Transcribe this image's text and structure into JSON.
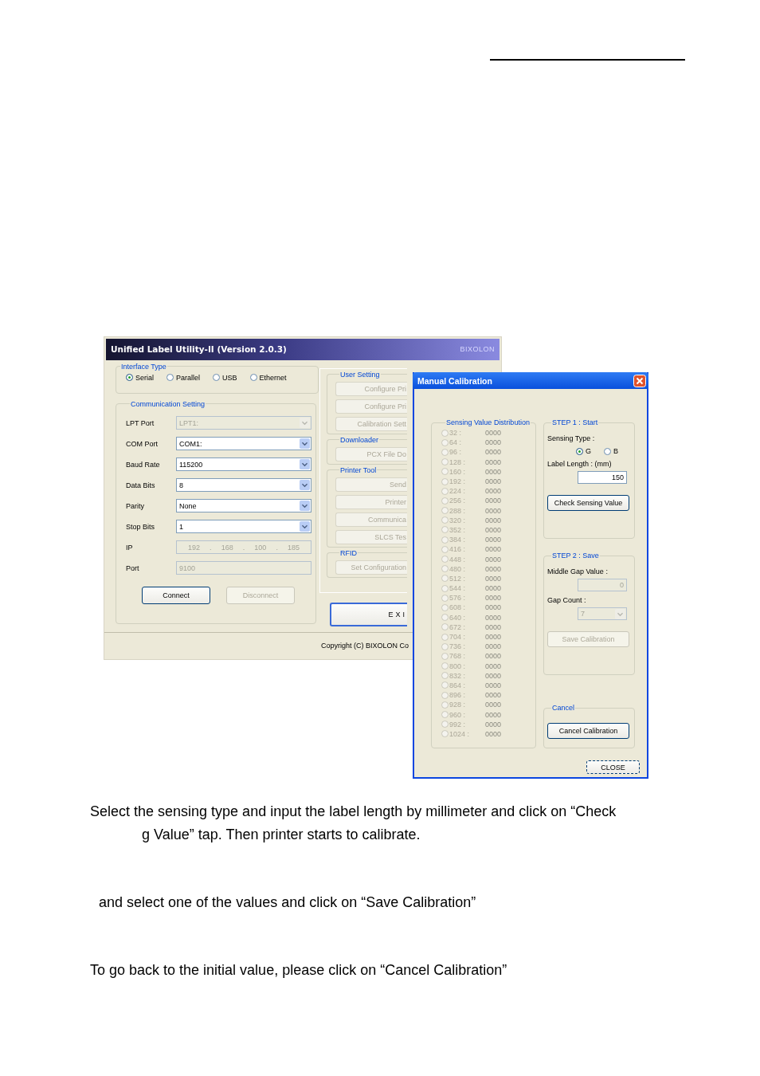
{
  "main_window": {
    "title": "Unified Label Utility-II (Version 2.0.3)",
    "brand": "BIXOLON",
    "interface_type": {
      "label": "Interface Type",
      "options": [
        {
          "label": "Serial",
          "selected": true
        },
        {
          "label": "Parallel",
          "selected": false
        },
        {
          "label": "USB",
          "selected": false
        },
        {
          "label": "Ethernet",
          "selected": false
        }
      ]
    },
    "communication": {
      "label": "Communication Setting",
      "fields": [
        {
          "label": "LPT Port",
          "kind": "dropdown",
          "value": "LPT1:",
          "disabled": true
        },
        {
          "label": "COM Port",
          "kind": "dropdown",
          "value": "COM1:",
          "disabled": false
        },
        {
          "label": "Baud Rate",
          "kind": "dropdown",
          "value": "115200",
          "disabled": false
        },
        {
          "label": "Data Bits",
          "kind": "dropdown",
          "value": "8",
          "disabled": false
        },
        {
          "label": "Parity",
          "kind": "dropdown",
          "value": "None",
          "disabled": false
        },
        {
          "label": "Stop Bits",
          "kind": "dropdown",
          "value": "1",
          "disabled": false
        },
        {
          "label": "IP",
          "kind": "ip",
          "parts": [
            "192",
            "168",
            "100",
            "185"
          ],
          "separator": ".",
          "disabled": true
        },
        {
          "label": "Port",
          "kind": "text",
          "value": "9100",
          "disabled": true
        }
      ],
      "buttons": [
        {
          "label": "Connect",
          "disabled": false
        },
        {
          "label": "Disconnect",
          "disabled": true
        }
      ]
    },
    "right_groups": [
      {
        "label": "User Setting",
        "buttons": [
          "Configure Pri",
          "Configure Pri",
          "Calibration Sett"
        ]
      },
      {
        "label": "Downloader",
        "buttons": [
          "PCX File Do"
        ]
      },
      {
        "label": "Printer Tool",
        "buttons": [
          "Send",
          "Printer",
          "Communica",
          "SLCS Tes"
        ]
      },
      {
        "label": "RFID",
        "buttons": [
          "Set Configuration"
        ]
      }
    ],
    "exit_button": "EXI",
    "copyright": "Copyright (C) BIXOLON Co"
  },
  "dialog": {
    "title": "Manual Calibration",
    "distribution": {
      "label": "Sensing Value Distribution",
      "rows": [
        {
          "label": "32 :",
          "value": "0000",
          "selected": false
        },
        {
          "label": "64 :",
          "value": "0000",
          "selected": false
        },
        {
          "label": "96 :",
          "value": "0000",
          "selected": false
        },
        {
          "label": "128 :",
          "value": "0000",
          "selected": false
        },
        {
          "label": "160 :",
          "value": "0000",
          "selected": false
        },
        {
          "label": "192 :",
          "value": "0000",
          "selected": false
        },
        {
          "label": "224 :",
          "value": "0000",
          "selected": false
        },
        {
          "label": "256 :",
          "value": "0000",
          "selected": false
        },
        {
          "label": "288 :",
          "value": "0000",
          "selected": false
        },
        {
          "label": "320 :",
          "value": "0000",
          "selected": false
        },
        {
          "label": "352 :",
          "value": "0000",
          "selected": false
        },
        {
          "label": "384 :",
          "value": "0000",
          "selected": false
        },
        {
          "label": "416 :",
          "value": "0000",
          "selected": false
        },
        {
          "label": "448 :",
          "value": "0000",
          "selected": false
        },
        {
          "label": "480 :",
          "value": "0000",
          "selected": false
        },
        {
          "label": "512 :",
          "value": "0000",
          "selected": false
        },
        {
          "label": "544 :",
          "value": "0000",
          "selected": false
        },
        {
          "label": "576 :",
          "value": "0000",
          "selected": false
        },
        {
          "label": "608 :",
          "value": "0000",
          "selected": false
        },
        {
          "label": "640 :",
          "value": "0000",
          "selected": false
        },
        {
          "label": "672 :",
          "value": "0000",
          "selected": false
        },
        {
          "label": "704 :",
          "value": "0000",
          "selected": false
        },
        {
          "label": "736 :",
          "value": "0000",
          "selected": false
        },
        {
          "label": "768 :",
          "value": "0000",
          "selected": false
        },
        {
          "label": "800 :",
          "value": "0000",
          "selected": false
        },
        {
          "label": "832 :",
          "value": "0000",
          "selected": false
        },
        {
          "label": "864 :",
          "value": "0000",
          "selected": false
        },
        {
          "label": "896 :",
          "value": "0000",
          "selected": false
        },
        {
          "label": "928 :",
          "value": "0000",
          "selected": false
        },
        {
          "label": "960 :",
          "value": "0000",
          "selected": false
        },
        {
          "label": "992 :",
          "value": "0000",
          "selected": false
        },
        {
          "label": "1024 :",
          "value": "0000",
          "selected": false
        }
      ]
    },
    "step1": {
      "label": "STEP 1 : Start",
      "sensing_type_label": "Sensing Type :",
      "sensing_types": [
        {
          "label": "G",
          "selected": true
        },
        {
          "label": "B",
          "selected": false
        }
      ],
      "length_label": "Label Length : (mm)",
      "length_value": "150",
      "button": "Check Sensing Value"
    },
    "step2": {
      "label": "STEP 2 : Save",
      "gap_label": "Middle Gap Value :",
      "gap_value": "0",
      "count_label": "Gap Count :",
      "count_value": "7",
      "button": "Save Calibration",
      "disabled": true
    },
    "cancel": {
      "label": "Cancel",
      "button": "Cancel Calibration"
    },
    "close_button": "CLOSE"
  },
  "document": {
    "paragraphs": [
      {
        "lines": [
          "Select the sensing type and input the label length by millimeter and click on “Check",
          "g Value” tap. Then printer starts to calibrate."
        ]
      },
      {
        "lines": [
          " and select one of the values and click on “Save Calibration”"
        ]
      },
      {
        "lines": [
          "To go back to the initial value, please click on “Cancel Calibration”"
        ]
      }
    ]
  }
}
